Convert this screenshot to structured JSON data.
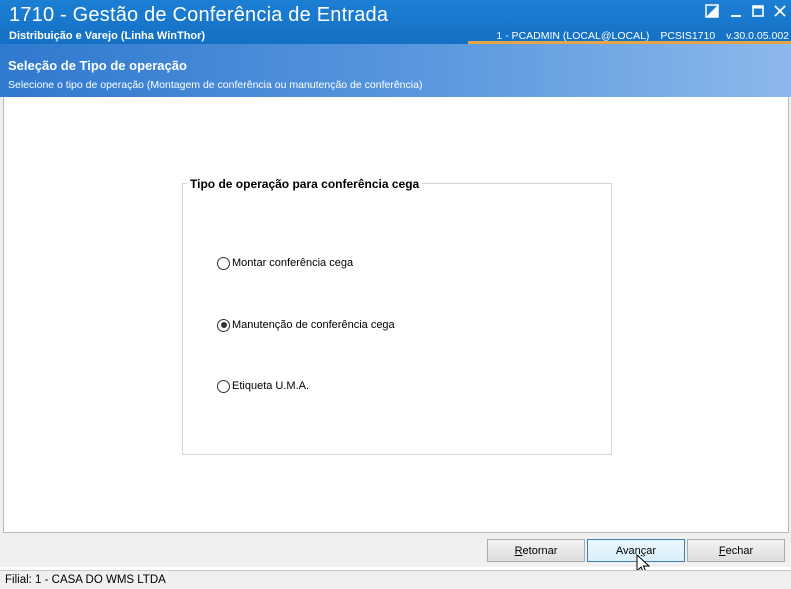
{
  "window": {
    "title": "1710 - Gestão de Conferência de Entrada",
    "subtitle": "Distribuição e Varejo (Linha WinThor)",
    "info": {
      "user": "1 - PCADMIN (LOCAL@LOCAL)",
      "program": "PCSIS1710",
      "version": "v.30.0.05.002"
    },
    "controls": {
      "restore_icon": "restore-icon",
      "minimize_icon": "minimize-icon",
      "maximize_icon": "maximize-icon",
      "close_icon": "close-icon"
    },
    "accent_color": "#e3a646"
  },
  "header": {
    "title": "Seleção de Tipo de operação",
    "description": "Selecione o tipo de operação (Montagem de conferência ou manutenção de conferência)"
  },
  "group": {
    "legend": "Tipo de operação para conferência cega",
    "options": [
      {
        "label": "Montar conferência cega",
        "checked": false
      },
      {
        "label": "Manutenção de conferência cega",
        "checked": true
      },
      {
        "label": "Etiqueta U.M.A.",
        "checked": false
      }
    ]
  },
  "buttons": {
    "retornar": {
      "first": "R",
      "rest": "etornar"
    },
    "avancar": {
      "before": "Avan",
      "mid": "ç",
      "after": "ar"
    },
    "fechar": {
      "first": "F",
      "rest": "echar"
    }
  },
  "status": {
    "filial": "Filial: 1 - CASA DO WMS LTDA"
  }
}
